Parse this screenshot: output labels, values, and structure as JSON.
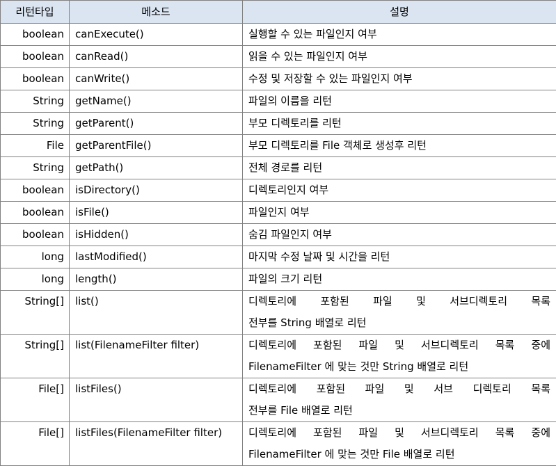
{
  "header": {
    "type": "리턴타입",
    "method": "메소드",
    "desc": "설명"
  },
  "rows": [
    {
      "type": "boolean",
      "method": "canExecute()",
      "desc": [
        "실행할 수 있는 파일인지 여부"
      ]
    },
    {
      "type": "boolean",
      "method": "canRead()",
      "desc": [
        "읽을 수 있는 파일인지 여부"
      ]
    },
    {
      "type": "boolean",
      "method": "canWrite()",
      "desc": [
        "수정 및 저장할 수 있는 파일인지 여부"
      ]
    },
    {
      "type": "String",
      "method": "getName()",
      "desc": [
        "파일의 이름을 리턴"
      ]
    },
    {
      "type": "String",
      "method": "getParent()",
      "desc": [
        "부모 디렉토리를 리턴"
      ]
    },
    {
      "type": "File",
      "method": "getParentFile()",
      "desc": [
        "부모 디렉토리를 File 객체로 생성후 리턴"
      ]
    },
    {
      "type": "String",
      "method": "getPath()",
      "desc": [
        "전체 경로를 리턴"
      ]
    },
    {
      "type": "boolean",
      "method": "isDirectory()",
      "desc": [
        "디렉토리인지 여부"
      ]
    },
    {
      "type": "boolean",
      "method": "isFile()",
      "desc": [
        "파일인지 여부"
      ]
    },
    {
      "type": "boolean",
      "method": "isHidden()",
      "desc": [
        "숨김 파일인지 여부"
      ]
    },
    {
      "type": "long",
      "method": "lastModified()",
      "desc": [
        "마지막 수정 날짜 및 시간을 리턴"
      ]
    },
    {
      "type": "long",
      "method": "length()",
      "desc": [
        "파일의 크기 리턴"
      ]
    },
    {
      "type": "String[]",
      "method": "list()",
      "desc": [
        "디렉토리에 포함된 파일 및 서브디렉토리 목록",
        "전부를 String 배열로 리턴"
      ]
    },
    {
      "type": "String[]",
      "method": "list(FilenameFilter filter)",
      "desc": [
        "디렉토리에 포함된 파일 및 서브디렉토리 목록 중에",
        "FilenameFilter 에 맞는 것만 String 배열로 리턴"
      ]
    },
    {
      "type": "File[]",
      "method": "listFiles()",
      "desc": [
        "디렉토리에 포함된 파일 및 서브 디렉토리 목록",
        "전부를 File 배열로 리턴"
      ]
    },
    {
      "type": "File[]",
      "method": "listFiles(FilenameFilter filter)",
      "desc": [
        "디렉토리에 포함된 파일 및 서브디렉토리 목록 중에",
        "FilenameFilter 에 맞는 것만 File 배열로 리턴"
      ]
    }
  ]
}
